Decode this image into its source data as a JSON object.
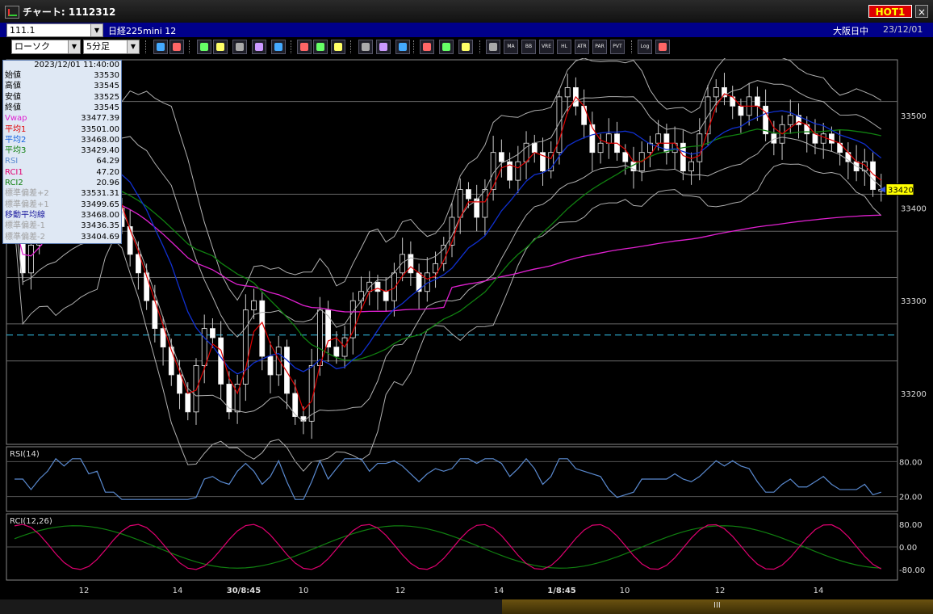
{
  "window": {
    "title": "チャート: 1112312",
    "hot_label": "HOT1",
    "close_label": "×"
  },
  "info": {
    "code": "111.1",
    "name": "日経225mini 12",
    "market": "大阪日中",
    "date": "23/12/01"
  },
  "toolbar": {
    "chart_type": "ローソク",
    "interval": "5分足",
    "buttons": [
      "zoom-icon",
      "crosshair-icon",
      "trend-icon",
      "find-icon",
      "grid-icon",
      "candle-icon",
      "settings-icon",
      "bar-icon",
      "bar-icon",
      "all-icon",
      "pen-icon",
      "cursor-icon",
      "arrow-icon",
      "paint-icon",
      "brush-icon",
      "color-icon",
      "grid-icon",
      "MA",
      "BB",
      "VRE",
      "HL",
      "ATR",
      "PAR",
      "PVT",
      "Log",
      "sheet-icon"
    ]
  },
  "data_panel": {
    "timestamp": "2023/12/01  11:40:00",
    "rows": [
      {
        "label": "始値",
        "value": "33530",
        "color": "#000000"
      },
      {
        "label": "高値",
        "value": "33545",
        "color": "#000000"
      },
      {
        "label": "安値",
        "value": "33525",
        "color": "#000000"
      },
      {
        "label": "終値",
        "value": "33545",
        "color": "#000000"
      },
      {
        "label": "Vwap",
        "value": "33477.39",
        "color": "#e020d0"
      },
      {
        "label": "平均1",
        "value": "33501.00",
        "color": "#e00000"
      },
      {
        "label": "平均2",
        "value": "33468.00",
        "color": "#1060e0"
      },
      {
        "label": "平均3",
        "value": "33429.40",
        "color": "#108010"
      },
      {
        "label": "RSI",
        "value": "64.29",
        "color": "#5a8ad0"
      },
      {
        "label": "RCI1",
        "value": "47.20",
        "color": "#e00070"
      },
      {
        "label": "RCI2",
        "value": "20.96",
        "color": "#108010"
      },
      {
        "label": "標準偏差+2",
        "value": "33531.31",
        "color": "#a0a0a0"
      },
      {
        "label": "標準偏差+1",
        "value": "33499.65",
        "color": "#a0a0a0"
      },
      {
        "label": "移動平均線",
        "value": "33468.00",
        "color": "#2020a0"
      },
      {
        "label": "標準偏差-1",
        "value": "33436.35",
        "color": "#a0a0a0"
      },
      {
        "label": "標準偏差-2",
        "value": "33404.69",
        "color": "#a0a0a0"
      }
    ]
  },
  "price_axis": {
    "labels": [
      "33500",
      "33400",
      "33300",
      "33200"
    ],
    "current": "33420"
  },
  "rsi_panel": {
    "title": "RSI(14)",
    "labels": [
      "80.00",
      "20.00"
    ]
  },
  "rci_panel": {
    "title": "RCI(12,26)",
    "labels": [
      "80.00",
      "0.00",
      "-80.00"
    ]
  },
  "time_axis": {
    "labels": [
      "12",
      "14",
      "30/8:45",
      "10",
      "12",
      "14",
      "1/8:45",
      "10",
      "12",
      "14"
    ]
  },
  "bottom_bar": {
    "handle_label": "III"
  },
  "colors": {
    "candle_up": "#000000",
    "candle_down": "#ffffff",
    "bg": "#000000",
    "ma1": "#e00000",
    "ma2": "#1030d0",
    "ma3": "#108010",
    "vwap": "#e020d0",
    "bands": "#b0b0b0",
    "rsi": "#5a8ad0",
    "rci1": "#e00070",
    "rci2": "#108010"
  },
  "chart_data": {
    "type": "candlestick",
    "ylim": [
      33145,
      33560
    ],
    "closes": [
      33400,
      33330,
      33360,
      33400,
      33430,
      33480,
      33450,
      33470,
      33440,
      33420,
      33460,
      33430,
      33400,
      33380,
      33350,
      33330,
      33300,
      33270,
      33250,
      33220,
      33200,
      33180,
      33230,
      33270,
      33260,
      33210,
      33180,
      33210,
      33290,
      33300,
      33240,
      33220,
      33250,
      33200,
      33175,
      33170,
      33230,
      33290,
      33250,
      33240,
      33260,
      33300,
      33310,
      33320,
      33310,
      33300,
      33330,
      33350,
      33330,
      33310,
      33330,
      33340,
      33360,
      33390,
      33420,
      33410,
      33390,
      33420,
      33460,
      33450,
      33430,
      33450,
      33470,
      33460,
      33440,
      33460,
      33520,
      33530,
      33510,
      33490,
      33460,
      33470,
      33480,
      33460,
      33450,
      33440,
      33460,
      33470,
      33480,
      33460,
      33470,
      33440,
      33450,
      33480,
      33520,
      33530,
      33520,
      33510,
      33500,
      33520,
      33510,
      33480,
      33470,
      33490,
      33500,
      33490,
      33480,
      33470,
      33480,
      33470,
      33460,
      33450,
      33440,
      33450,
      33420,
      33420
    ]
  }
}
